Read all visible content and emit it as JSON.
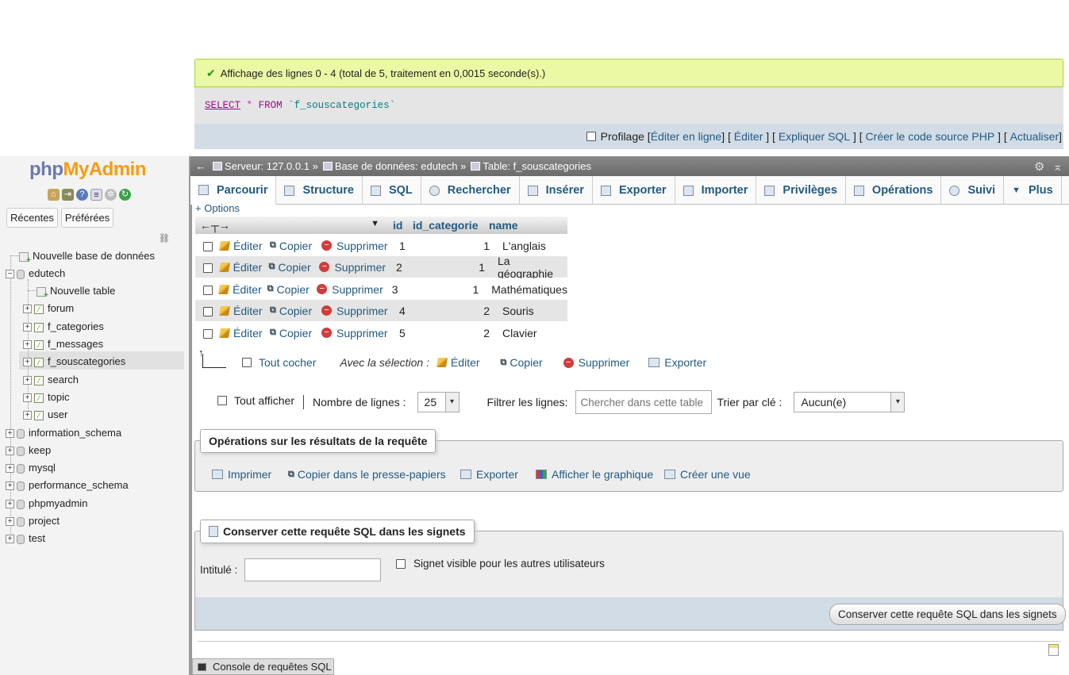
{
  "message": {
    "success": "Affichage des lignes 0 - 4 (total de 5, traitement en 0,0015 seconde(s).)"
  },
  "query": {
    "kw1": "SELECT",
    "star": "*",
    "kw2": "FROM",
    "table": "`f_souscategories`"
  },
  "query_bar": {
    "profilage": "Profilage",
    "links": [
      "Éditer en ligne",
      "Éditer",
      "Expliquer SQL",
      "Créer le code source PHP",
      "Actualiser"
    ]
  },
  "nav": {
    "logo_php": "php",
    "logo_myadmin": "MyAdmin",
    "tabs": [
      "Récentes",
      "Préférées"
    ],
    "new_db": "Nouvelle base de données",
    "db_current": "edutech",
    "new_table": "Nouvelle table",
    "tables": [
      "forum",
      "f_categories",
      "f_messages",
      "f_souscategories",
      "search",
      "topic",
      "user"
    ],
    "databases": [
      "information_schema",
      "keep",
      "mysql",
      "performance_schema",
      "phpmyadmin",
      "project",
      "test"
    ]
  },
  "breadcrumb": {
    "server": "Serveur: 127.0.0.1",
    "database": "Base de données: edutech",
    "table": "Table: f_souscategories",
    "sep": "»"
  },
  "tabs": [
    "Parcourir",
    "Structure",
    "SQL",
    "Rechercher",
    "Insérer",
    "Exporter",
    "Importer",
    "Privilèges",
    "Opérations",
    "Suivi",
    "Plus"
  ],
  "options_link": "+ Options",
  "table": {
    "columns": [
      "id",
      "id_categorie",
      "name"
    ],
    "action_labels": {
      "edit": "Éditer",
      "copy": "Copier",
      "delete": "Supprimer"
    },
    "rows": [
      {
        "id": "1",
        "id_categorie": "1",
        "name": "L'anglais"
      },
      {
        "id": "2",
        "id_categorie": "1",
        "name": "La géographie"
      },
      {
        "id": "3",
        "id_categorie": "1",
        "name": "Mathématiques"
      },
      {
        "id": "4",
        "id_categorie": "2",
        "name": "Souris"
      },
      {
        "id": "5",
        "id_categorie": "2",
        "name": "Clavier"
      }
    ]
  },
  "bulk": {
    "check_all": "Tout cocher",
    "with_selection": "Avec la sélection :",
    "edit": "Éditer",
    "copy": "Copier",
    "delete": "Supprimer",
    "export": "Exporter"
  },
  "navigation": {
    "show_all": "Tout afficher",
    "rows_label": "Nombre de lignes :",
    "rows_value": "25",
    "filter_label": "Filtrer les lignes:",
    "filter_placeholder": "Chercher dans cette table",
    "sort_label": "Trier par clé :",
    "sort_value": "Aucun(e)"
  },
  "query_ops": {
    "legend": "Opérations sur les résultats de la requête",
    "items": [
      "Imprimer",
      "Copier dans le presse-papiers",
      "Exporter",
      "Afficher le graphique",
      "Créer une vue"
    ]
  },
  "bookmark": {
    "legend": "Conserver cette requête SQL dans les signets",
    "label": "Intitulé :",
    "visible": "Signet visible pour les autres utilisateurs",
    "button": "Conserver cette requête SQL dans les signets"
  },
  "console": {
    "label": "Console de requêtes SQL"
  }
}
